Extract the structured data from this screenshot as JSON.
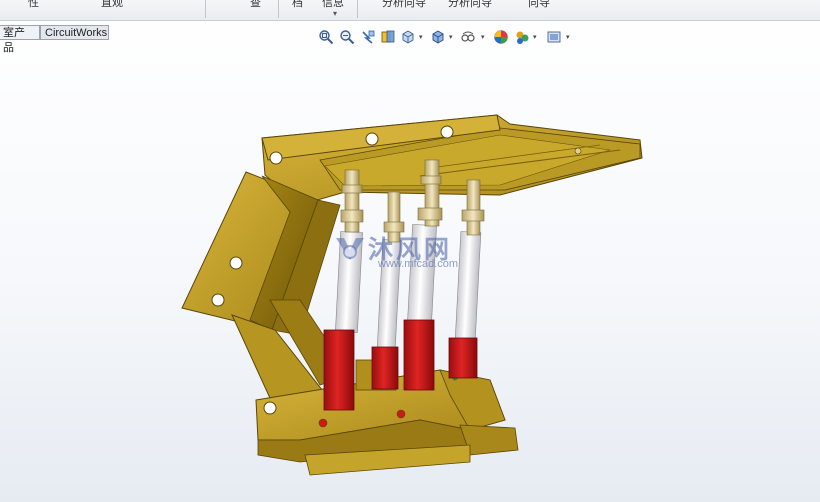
{
  "ribbon": {
    "items": [
      "性",
      "直观",
      "查",
      "档",
      "信息",
      "分析向导",
      "分析向导",
      "向导"
    ]
  },
  "tabs": [
    "室产品",
    "CircuitWorks"
  ],
  "view_toolbar": {
    "icons": [
      "zoom-to-fit-icon",
      "zoom-area-icon",
      "previous-view-icon",
      "section-view-icon",
      "view-orientation-icon",
      "display-style-icon",
      "hide-show-items-icon",
      "edit-appearance-icon",
      "apply-scene-icon",
      "view-settings-icon"
    ]
  },
  "watermark": {
    "text": "沐风网",
    "url": "www.mfcad.com"
  },
  "colors": {
    "frame": "#c8a425",
    "frame_dark": "#8a6d10",
    "cylinder": "#cc1a1a",
    "piston": "#f4f4f6",
    "gland": "#e8d9a8"
  }
}
